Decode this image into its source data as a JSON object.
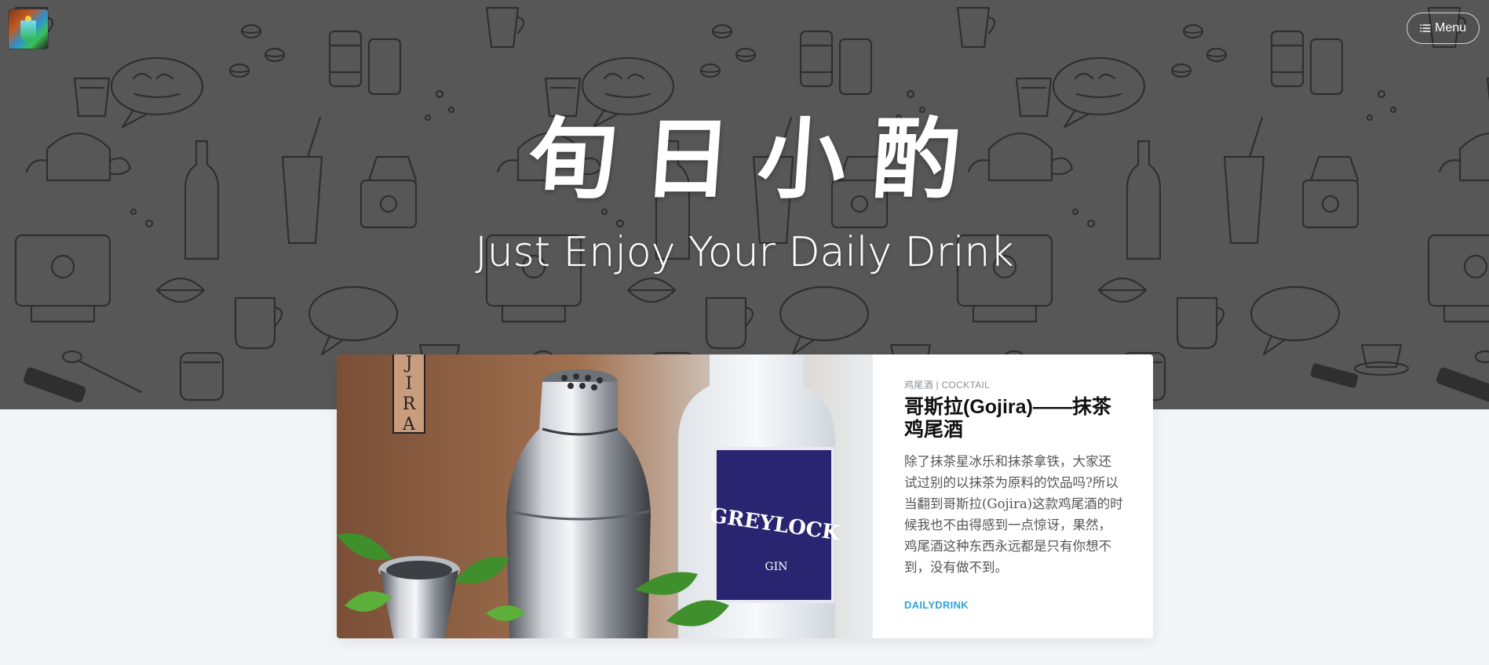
{
  "site": {
    "title": "旬日小酌",
    "tagline": "Just Enjoy Your Daily Drink",
    "logo_icon": "drink-logo-icon"
  },
  "nav": {
    "menu_label": "Menu",
    "menu_icon": "hamburger-icon"
  },
  "colors": {
    "hero_background": "#575757",
    "page_background": "#f2f5f8",
    "accent": "#2ea3d5"
  },
  "post": {
    "category": "鸡尾酒 | COCKTAIL",
    "title": "哥斯拉(Gojira)——抹茶鸡尾酒",
    "excerpt": "除了抹茶星冰乐和抹茶拿铁，大家还试过别的以抹茶为原料的饮品吗?所以当翻到哥斯拉(Gojira)这款鸡尾酒的时候我也不由得感到一点惊讶，果然，鸡尾酒这种东西永远都是只有你想不到，没有做不到。",
    "author": "DAILYDRINK",
    "image_label": "JIRA",
    "bottle_label": "GREYLOCK",
    "bottle_sublabel": "GIN"
  }
}
